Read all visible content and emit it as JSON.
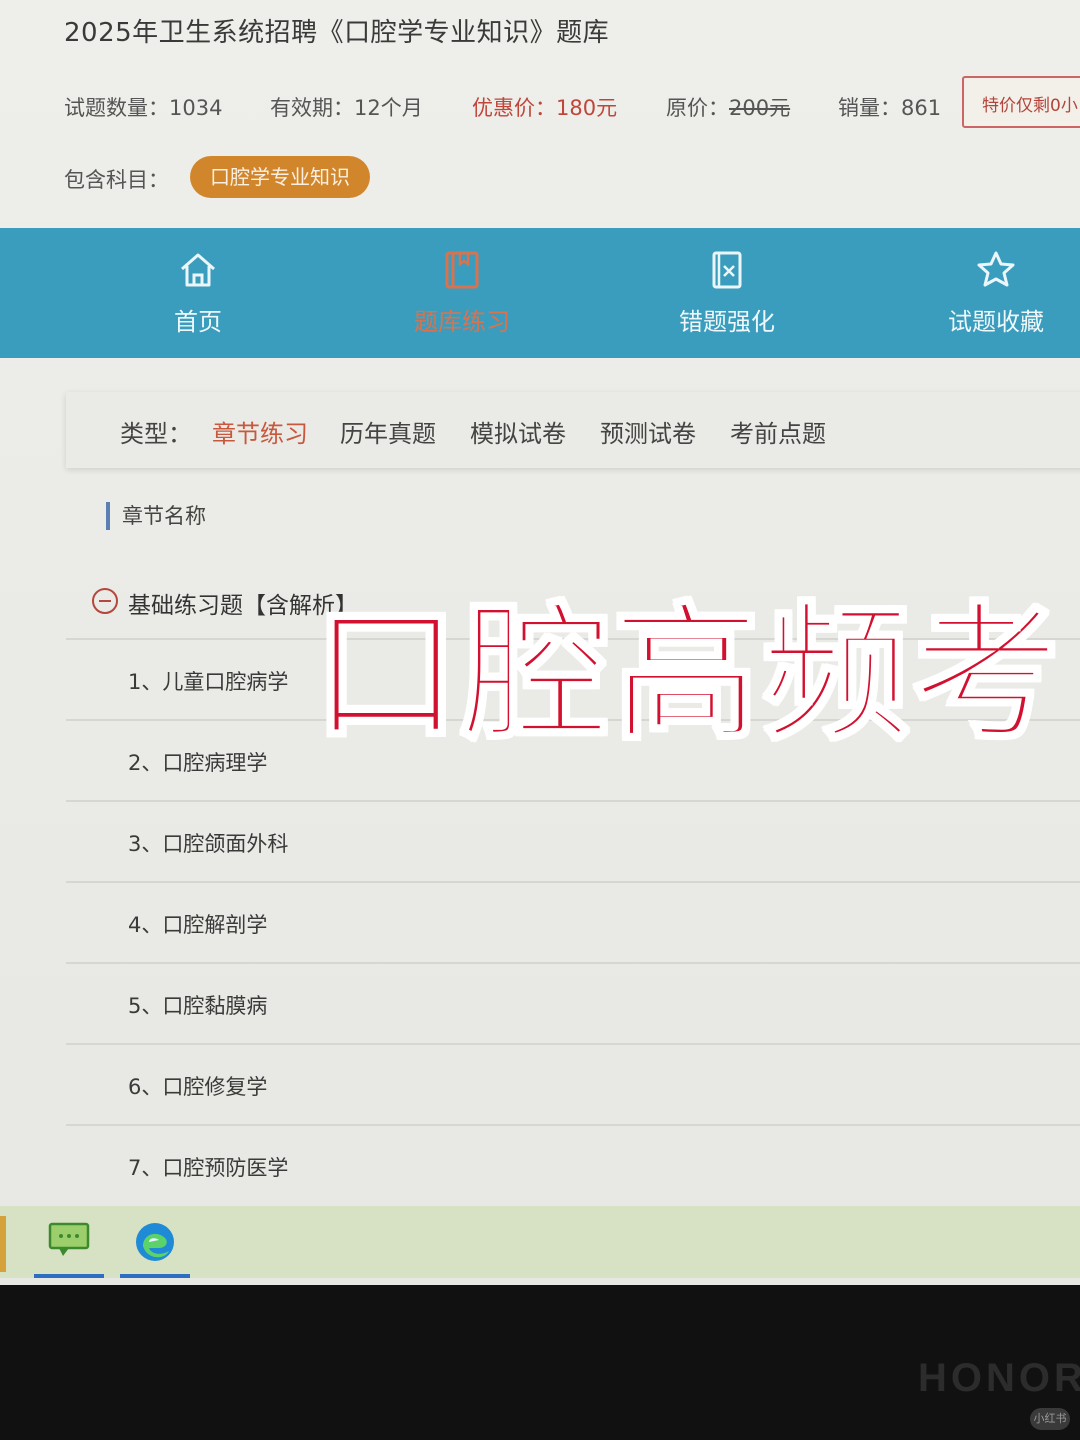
{
  "page": {
    "title": "2025年卫生系统招聘《口腔学专业知识》题库"
  },
  "info": {
    "count": "试题数量：1034",
    "validity": "有效期：12个月",
    "sale_price": "优惠价：180元",
    "orig_label": "原价：",
    "orig_value": "200元",
    "sold": "销量：861",
    "promo": "特价仅剩0小"
  },
  "subject": {
    "label": "包含科目：",
    "value": "口腔学专业知识"
  },
  "nav": {
    "items": [
      {
        "label": "首页",
        "icon": "home-icon"
      },
      {
        "label": "题库练习",
        "icon": "book-icon",
        "active": true
      },
      {
        "label": "错题强化",
        "icon": "wrong-doc-icon"
      },
      {
        "label": "试题收藏",
        "icon": "star-icon"
      }
    ]
  },
  "types": {
    "label": "类型：",
    "items": [
      "章节练习",
      "历年真题",
      "模拟试卷",
      "预测试卷",
      "考前点题"
    ],
    "selected": "章节练习",
    "selected_color": "#c7583e"
  },
  "chapters": {
    "header": "章节名称",
    "group": "基础练习题【含解析】",
    "items": [
      "1、儿童口腔病学",
      "2、口腔病理学",
      "3、口腔颌面外科",
      "4、口腔解剖学",
      "5、口腔黏膜病",
      "6、口腔修复学",
      "7、口腔预防医学"
    ]
  },
  "overlay": {
    "headline": "口腔高频考",
    "color": "#d2102f"
  },
  "device": {
    "brand": "HONOR",
    "watermark": "小红书"
  },
  "colors": {
    "nav_bg": "#3b9dbd",
    "pill_bg": "#d2862b",
    "accent_red": "#c0463a"
  }
}
